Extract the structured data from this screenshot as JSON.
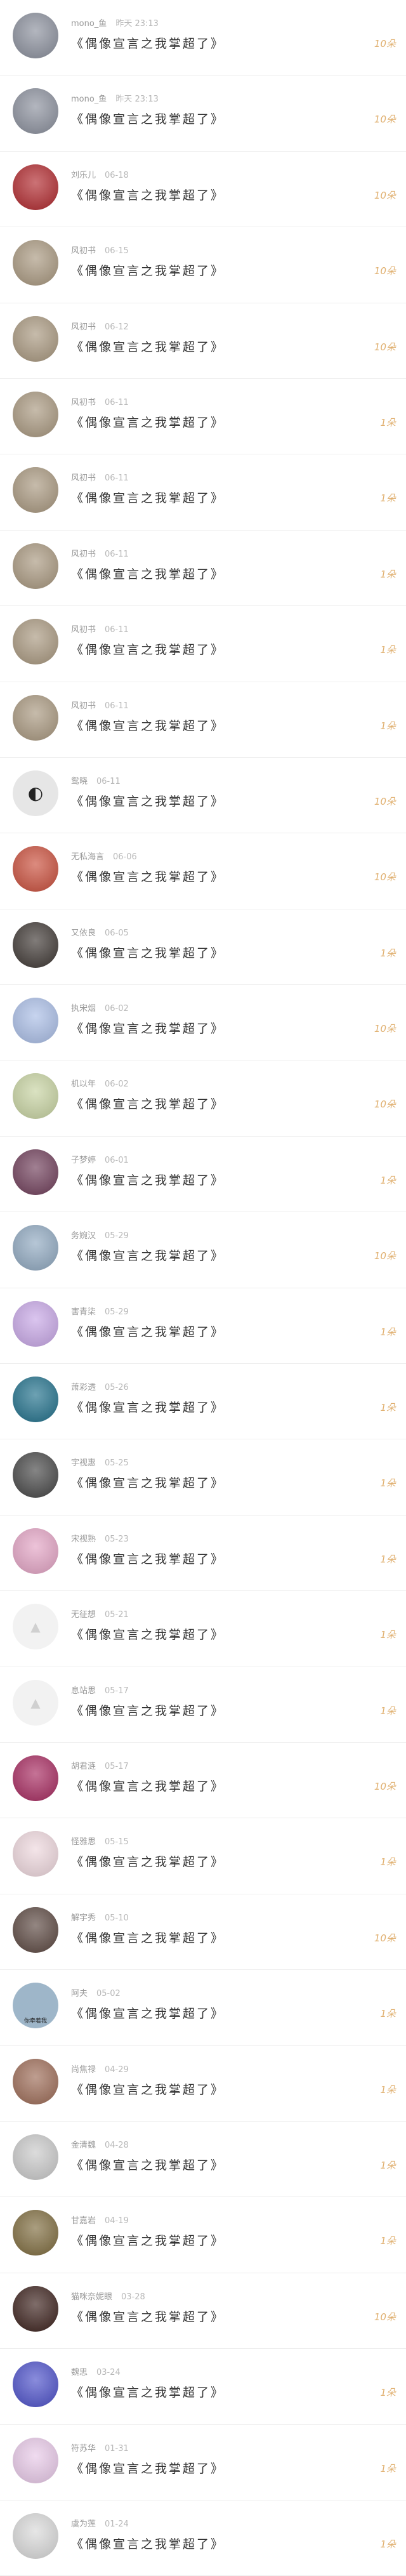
{
  "records": [
    {
      "user": "mono_鱼",
      "time": "昨天 23:13",
      "title": "《偶像宣言之我掌超了》",
      "amount": "10朵",
      "avatar": "bunny-photo",
      "avatar_color": "#8a8f9c"
    },
    {
      "user": "mono_鱼",
      "time": "昨天 23:13",
      "title": "《偶像宣言之我掌超了》",
      "amount": "10朵",
      "avatar": "bunny-photo",
      "avatar_color": "#8a8f9c"
    },
    {
      "user": "刘乐儿",
      "time": "06-18",
      "title": "《偶像宣言之我掌超了》",
      "amount": "10朵",
      "avatar": "anime-girl-red",
      "avatar_color": "#b0272c"
    },
    {
      "user": "风初书",
      "time": "06-15",
      "title": "《偶像宣言之我掌超了》",
      "amount": "10朵",
      "avatar": "cat-photo",
      "avatar_color": "#a8977e"
    },
    {
      "user": "风初书",
      "time": "06-12",
      "title": "《偶像宣言之我掌超了》",
      "amount": "10朵",
      "avatar": "cat-photo",
      "avatar_color": "#a8977e"
    },
    {
      "user": "风初书",
      "time": "06-11",
      "title": "《偶像宣言之我掌超了》",
      "amount": "1朵",
      "avatar": "cat-photo",
      "avatar_color": "#a8977e"
    },
    {
      "user": "风初书",
      "time": "06-11",
      "title": "《偶像宣言之我掌超了》",
      "amount": "1朵",
      "avatar": "cat-photo",
      "avatar_color": "#a8977e"
    },
    {
      "user": "风初书",
      "time": "06-11",
      "title": "《偶像宣言之我掌超了》",
      "amount": "1朵",
      "avatar": "cat-photo",
      "avatar_color": "#a8977e"
    },
    {
      "user": "风初书",
      "time": "06-11",
      "title": "《偶像宣言之我掌超了》",
      "amount": "1朵",
      "avatar": "cat-photo",
      "avatar_color": "#a8977e"
    },
    {
      "user": "风初书",
      "time": "06-11",
      "title": "《偶像宣言之我掌超了》",
      "amount": "1朵",
      "avatar": "cat-photo",
      "avatar_color": "#a8977e"
    },
    {
      "user": "鸳晓",
      "time": "06-11",
      "title": "《偶像宣言之我掌超了》",
      "amount": "10朵",
      "avatar": "penguin-drawing",
      "avatar_color": "#e6e6e6"
    },
    {
      "user": "无私海言",
      "time": "06-06",
      "title": "《偶像宣言之我掌超了》",
      "amount": "10朵",
      "avatar": "girl-on-road",
      "avatar_color": "#c94d3a"
    },
    {
      "user": "又依良",
      "time": "06-05",
      "title": "《偶像宣言之我掌超了》",
      "amount": "1朵",
      "avatar": "dark-portrait",
      "avatar_color": "#3d3632"
    },
    {
      "user": "执宋烟",
      "time": "06-02",
      "title": "《偶像宣言之我掌超了》",
      "amount": "10朵",
      "avatar": "blue-flowers",
      "avatar_color": "#a9bde6"
    },
    {
      "user": "机以年",
      "time": "06-02",
      "title": "《偶像宣言之我掌超了》",
      "amount": "10朵",
      "avatar": "green-illustration",
      "avatar_color": "#c7d3a1"
    },
    {
      "user": "子梦婷",
      "time": "06-01",
      "title": "《偶像宣言之我掌超了》",
      "amount": "1朵",
      "avatar": "dark-anime",
      "avatar_color": "#6e3c58"
    },
    {
      "user": "务婉汉",
      "time": "05-29",
      "title": "《偶像宣言之我掌超了》",
      "amount": "10朵",
      "avatar": "sky-landscape",
      "avatar_color": "#8fa8c0"
    },
    {
      "user": "害青柒",
      "time": "05-29",
      "title": "《偶像宣言之我掌超了》",
      "amount": "1朵",
      "avatar": "purple-anime",
      "avatar_color": "#c7a6e6"
    },
    {
      "user": "萧彩透",
      "time": "05-26",
      "title": "《偶像宣言之我掌超了》",
      "amount": "1朵",
      "avatar": "teal-art",
      "avatar_color": "#1f6f8a"
    },
    {
      "user": "宇视惠",
      "time": "05-25",
      "title": "《偶像宣言之我掌超了》",
      "amount": "1朵",
      "avatar": "bw-portrait",
      "avatar_color": "#444444"
    },
    {
      "user": "宋视熟",
      "time": "05-23",
      "title": "《偶像宣言之我掌超了》",
      "amount": "1朵",
      "avatar": "pink-character",
      "avatar_color": "#e3a3c4"
    },
    {
      "user": "无征想",
      "time": "05-21",
      "title": "《偶像宣言之我掌超了》",
      "amount": "1朵",
      "avatar": "placeholder",
      "avatar_color": "#f2f2f2"
    },
    {
      "user": "息站思",
      "time": "05-17",
      "title": "《偶像宣言之我掌超了》",
      "amount": "1朵",
      "avatar": "placeholder",
      "avatar_color": "#f2f2f2"
    },
    {
      "user": "胡君涟",
      "time": "05-17",
      "title": "《偶像宣言之我掌超了》",
      "amount": "10朵",
      "avatar": "magenta-anime",
      "avatar_color": "#a6285e"
    },
    {
      "user": "怪雅思",
      "time": "05-15",
      "title": "《偶像宣言之我掌超了》",
      "amount": "1朵",
      "avatar": "pale-anime",
      "avatar_color": "#eed7dd"
    },
    {
      "user": "解宇秀",
      "time": "05-10",
      "title": "《偶像宣言之我掌超了》",
      "amount": "10朵",
      "avatar": "dark-hair-girl",
      "avatar_color": "#5a463f"
    },
    {
      "user": "阿夫",
      "time": "05-02",
      "title": "《偶像宣言之我掌超了》",
      "amount": "1朵",
      "avatar": "photo-caption",
      "avatar_color": "#9eb6c9"
    },
    {
      "user": "尚焦禄",
      "time": "04-29",
      "title": "《偶像宣言之我掌超了》",
      "amount": "1朵",
      "avatar": "warm-portrait",
      "avatar_color": "#9c6a55"
    },
    {
      "user": "金清魏",
      "time": "04-28",
      "title": "《偶像宣言之我掌超了》",
      "amount": "1朵",
      "avatar": "gray-art",
      "avatar_color": "#c9c9c9"
    },
    {
      "user": "甘嘉岩",
      "time": "04-19",
      "title": "《偶像宣言之我掌超了》",
      "amount": "1朵",
      "avatar": "scenery",
      "avatar_color": "#7d6a3c"
    },
    {
      "user": "猫咪奈妮眼",
      "time": "03-28",
      "title": "《偶像宣言之我掌超了》",
      "amount": "10朵",
      "avatar": "violin-dark",
      "avatar_color": "#3a1f1a"
    },
    {
      "user": "魏思",
      "time": "03-24",
      "title": "《偶像宣言之我掌超了》",
      "amount": "1朵",
      "avatar": "colorful-art",
      "avatar_color": "#4b4fc9"
    },
    {
      "user": "符苏华",
      "time": "01-31",
      "title": "《偶像宣言之我掌超了》",
      "amount": "1朵",
      "avatar": "pastel-anime",
      "avatar_color": "#e8c9e8"
    },
    {
      "user": "虞为莲",
      "time": "01-24",
      "title": "《偶像宣言之我掌超了》",
      "amount": "1朵",
      "avatar": "sketch-girl",
      "avatar_color": "#d9d9d9"
    }
  ],
  "caption_avatar_text": "你牵着我"
}
